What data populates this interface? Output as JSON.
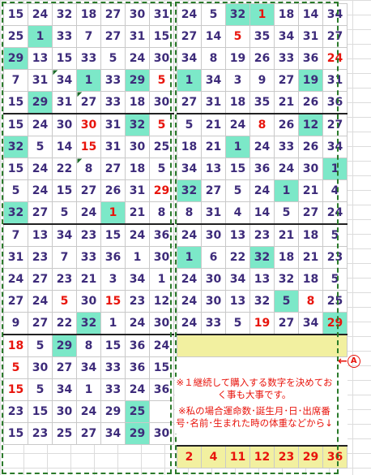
{
  "left_rows": [
    [
      "15",
      "24",
      "32",
      "18",
      "27",
      "30",
      "31"
    ],
    [
      "25",
      "1",
      "33",
      "7",
      "27",
      "31",
      "15"
    ],
    [
      "29",
      "13",
      "15",
      "33",
      "5",
      "24",
      "30"
    ],
    [
      "7",
      "31",
      "34",
      "1",
      "33",
      "29",
      "5"
    ],
    [
      "15",
      "29",
      "31",
      "27",
      "33",
      "18",
      "30"
    ],
    [
      "15",
      "24",
      "30",
      "30",
      "31",
      "32",
      "5"
    ],
    [
      "32",
      "5",
      "14",
      "15",
      "31",
      "30",
      "25"
    ],
    [
      "15",
      "24",
      "22",
      "8",
      "27",
      "18",
      "5"
    ],
    [
      "5",
      "24",
      "15",
      "27",
      "26",
      "31",
      "29"
    ],
    [
      "32",
      "27",
      "5",
      "24",
      "1",
      "21",
      "8"
    ],
    [
      "7",
      "13",
      "34",
      "23",
      "15",
      "24",
      "36"
    ],
    [
      "31",
      "23",
      "7",
      "33",
      "36",
      "1",
      "30"
    ],
    [
      "24",
      "27",
      "23",
      "21",
      "3",
      "34",
      "1"
    ],
    [
      "27",
      "24",
      "5",
      "30",
      "15",
      "23",
      "12"
    ],
    [
      "9",
      "27",
      "22",
      "32",
      "1",
      "24",
      "30"
    ],
    [
      "18",
      "5",
      "29",
      "8",
      "15",
      "36",
      "24"
    ],
    [
      "5",
      "30",
      "27",
      "34",
      "33",
      "36",
      "15"
    ],
    [
      "15",
      "5",
      "34",
      "1",
      "33",
      "24",
      "36"
    ],
    [
      "23",
      "15",
      "30",
      "24",
      "29",
      "25",
      ""
    ],
    [
      "15",
      "23",
      "25",
      "27",
      "34",
      "29",
      "30"
    ]
  ],
  "right_rows": [
    [
      "24",
      "5",
      "32",
      "1",
      "18",
      "14",
      "34"
    ],
    [
      "27",
      "14",
      "5",
      "35",
      "34",
      "31",
      "27"
    ],
    [
      "34",
      "8",
      "19",
      "26",
      "33",
      "36",
      "24"
    ],
    [
      "1",
      "34",
      "3",
      "9",
      "27",
      "19",
      "31"
    ],
    [
      "27",
      "31",
      "18",
      "35",
      "21",
      "26",
      "36"
    ],
    [
      "5",
      "21",
      "24",
      "8",
      "26",
      "12",
      "27"
    ],
    [
      "18",
      "21",
      "1",
      "24",
      "33",
      "26",
      "34"
    ],
    [
      "34",
      "13",
      "15",
      "36",
      "24",
      "30",
      "1"
    ],
    [
      "32",
      "27",
      "5",
      "24",
      "1",
      "21",
      "4"
    ],
    [
      "8",
      "31",
      "4",
      "14",
      "5",
      "27",
      "24"
    ],
    [
      "24",
      "30",
      "13",
      "23",
      "21",
      "18",
      "5"
    ],
    [
      "1",
      "6",
      "22",
      "32",
      "18",
      "21",
      "23"
    ],
    [
      "24",
      "30",
      "34",
      "13",
      "32",
      "18",
      "5"
    ],
    [
      "24",
      "30",
      "13",
      "32",
      "5",
      "8",
      "25"
    ],
    [
      "24",
      "33",
      "5",
      "19",
      "27",
      "34",
      "29"
    ]
  ],
  "result_row": [
    "2",
    "4",
    "11",
    "12",
    "23",
    "29",
    "36"
  ],
  "memo": {
    "p1": "※１継続して購入する数字を決めておく事も大事です。",
    "p2": "※私の場合運命数･誕生月･日･出席番号･名前･生まれた時の体重などから↓"
  },
  "marker": {
    "arrow": "←",
    "letter": "A"
  }
}
